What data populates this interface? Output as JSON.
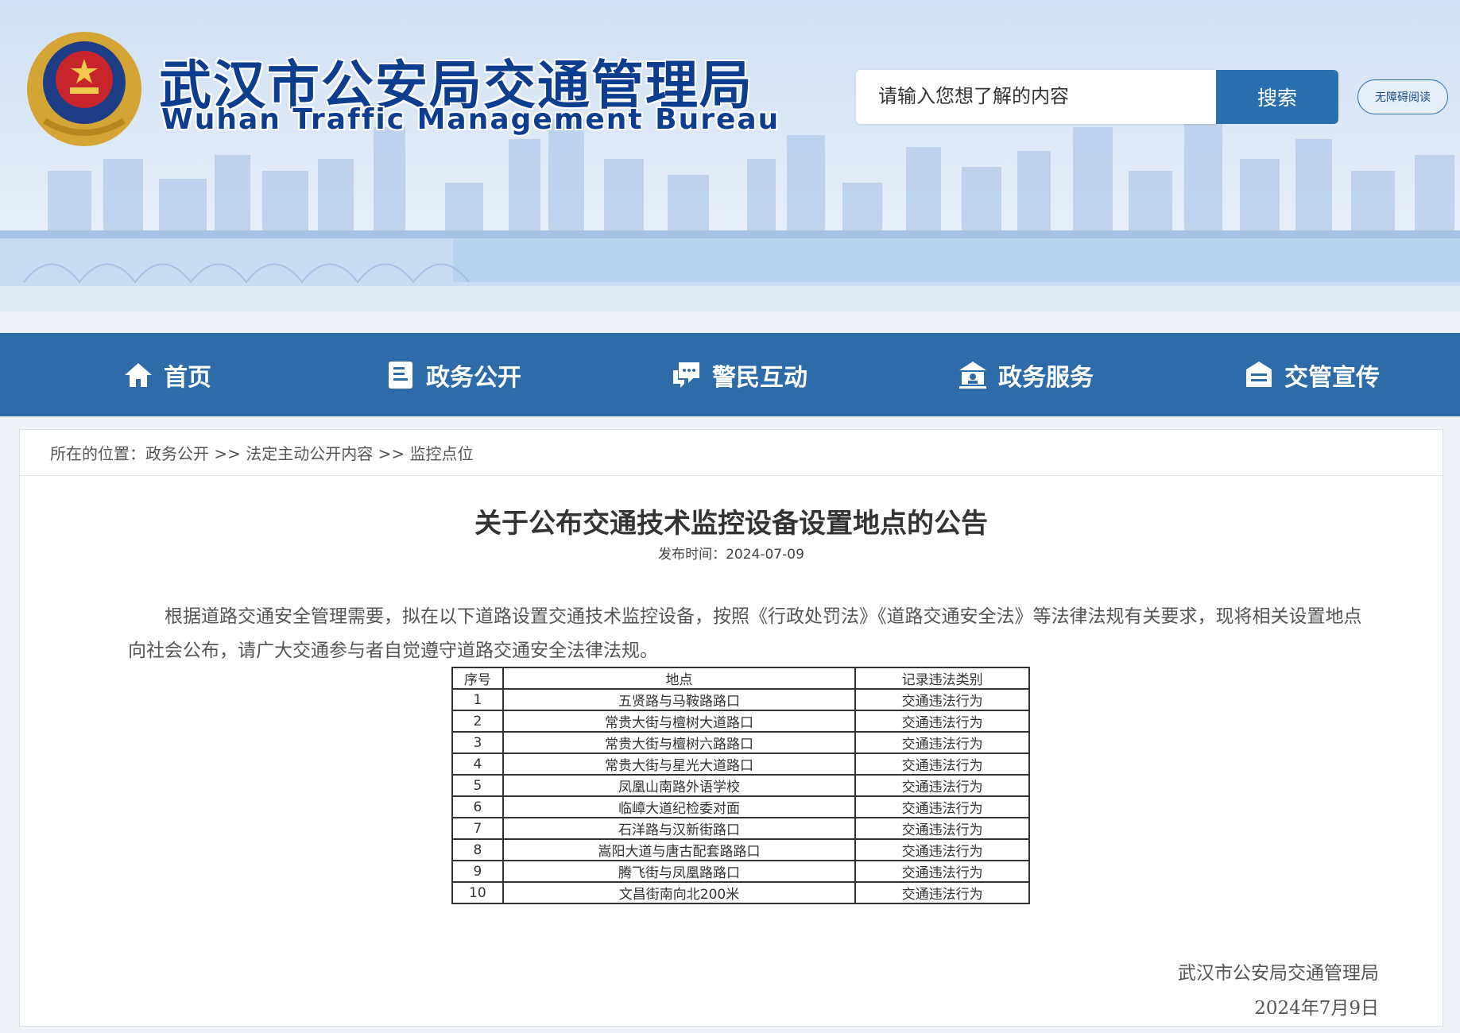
{
  "header": {
    "title_cn": "武汉市公安局交通管理局",
    "title_en": "Wuhan Traffic Management Bureau",
    "emblem_icon": "police-emblem",
    "search": {
      "placeholder": "请输入您想了解的内容",
      "button_label": "搜索"
    },
    "accessibility_label": "无障碍阅读"
  },
  "nav": {
    "items": [
      {
        "label": "首页",
        "icon": "home-icon"
      },
      {
        "label": "政务公开",
        "icon": "document-icon"
      },
      {
        "label": "警民互动",
        "icon": "chat-icon"
      },
      {
        "label": "政务服务",
        "icon": "service-icon"
      },
      {
        "label": "交管宣传",
        "icon": "publicity-icon"
      }
    ]
  },
  "breadcrumb": {
    "prefix": "所在的位置：",
    "items": [
      "政务公开",
      "法定主动公开内容",
      "监控点位"
    ],
    "separator": ">>"
  },
  "article": {
    "title": "关于公布交通技术监控设备设置地点的公告",
    "publish_label": "发布时间：2024-07-09",
    "paragraph": "根据道路交通安全管理需要，拟在以下道路设置交通技术监控设备，按照《行政处罚法》《道路交通安全法》等法律法规有关要求，现将相关设置地点向社会公布，请广大交通参与者自觉遵守道路交通安全法律法规。",
    "table": {
      "headers": [
        "序号",
        "地点",
        "记录违法类别"
      ],
      "rows": [
        [
          "1",
          "五贤路与马鞍路路口",
          "交通违法行为"
        ],
        [
          "2",
          "常贵大街与檀树大道路口",
          "交通违法行为"
        ],
        [
          "3",
          "常贵大街与檀树六路路口",
          "交通违法行为"
        ],
        [
          "4",
          "常贵大街与星光大道路口",
          "交通违法行为"
        ],
        [
          "5",
          "凤凰山南路外语学校",
          "交通违法行为"
        ],
        [
          "6",
          "临嶂大道纪检委对面",
          "交通违法行为"
        ],
        [
          "7",
          "石洋路与汉新街路口",
          "交通违法行为"
        ],
        [
          "8",
          "嵩阳大道与唐古配套路路口",
          "交通违法行为"
        ],
        [
          "9",
          "腾飞街与凤凰路路口",
          "交通违法行为"
        ],
        [
          "10",
          "文昌街南向北200米",
          "交通违法行为"
        ]
      ]
    },
    "signature": "武汉市公安局交通管理局",
    "signature_date": "2024年7月9日"
  },
  "colors": {
    "nav_bg": "#2d6ca8",
    "search_btn": "#2a6fad",
    "title_blue": "#0d3d8e"
  }
}
